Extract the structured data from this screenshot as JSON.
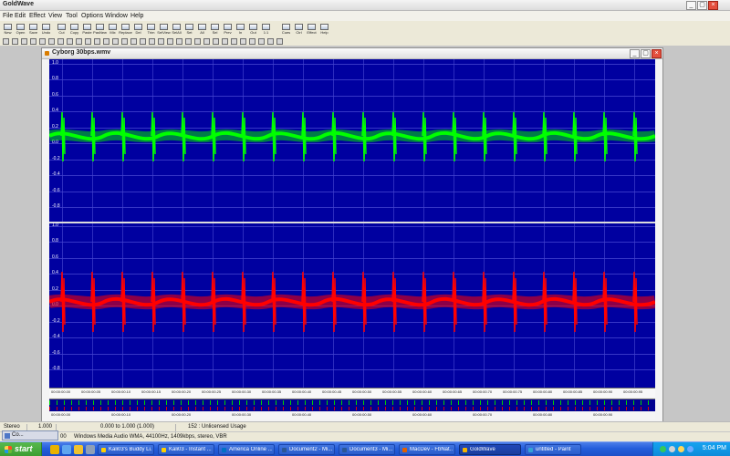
{
  "window": {
    "title": "GoldWave"
  },
  "menu": {
    "items": [
      "File",
      "Edit",
      "Effect",
      "View",
      "Tool",
      "Options",
      "Window",
      "Help"
    ]
  },
  "toolbar": {
    "main": [
      {
        "label": "New",
        "icon": "new-icon"
      },
      {
        "label": "Open",
        "icon": "open-icon"
      },
      {
        "label": "Save",
        "icon": "save-icon"
      },
      {
        "label": "Undo",
        "icon": "undo-icon"
      },
      {
        "label": "Cut",
        "icon": "cut-icon"
      },
      {
        "label": "Copy",
        "icon": "copy-icon"
      },
      {
        "label": "Paste",
        "icon": "paste-icon"
      },
      {
        "label": "PasNew",
        "icon": "paste-new-icon"
      },
      {
        "label": "Mix",
        "icon": "mix-icon"
      },
      {
        "label": "Replace",
        "icon": "replace-icon"
      },
      {
        "label": "Del",
        "icon": "delete-icon"
      },
      {
        "label": "Trim",
        "icon": "trim-icon"
      },
      {
        "label": "SelView",
        "icon": "select-view-icon"
      },
      {
        "label": "SelAll",
        "icon": "select-all-icon"
      },
      {
        "label": "Set",
        "icon": "set-icon"
      },
      {
        "label": "All",
        "icon": "all-icon"
      },
      {
        "label": "Sel",
        "icon": "select-icon"
      },
      {
        "label": "Prev",
        "icon": "prev-icon"
      },
      {
        "label": "In",
        "icon": "zoom-in-icon"
      },
      {
        "label": "Out",
        "icon": "zoom-out-icon"
      },
      {
        "label": "1:1",
        "icon": "zoom-one-icon"
      },
      {
        "label": "Cues",
        "icon": "cues-icon"
      },
      {
        "label": "Ctrl",
        "icon": "control-icon"
      },
      {
        "label": "Effect",
        "icon": "effect-icon"
      },
      {
        "label": "Help",
        "icon": "help-icon"
      }
    ]
  },
  "document": {
    "title": "Cyborg 30bps.wmv",
    "amplitude_labels": [
      "1.0",
      "0.8",
      "0.6",
      "0.4",
      "0.2",
      "0.0",
      "-0.2",
      "-0.4",
      "-0.6",
      "-0.8"
    ],
    "timeline_labels": [
      "00:00:00.00",
      "00:00:00.05",
      "00:00:00.10",
      "00:00:00.15",
      "00:00:00.20",
      "00:00:00.25",
      "00:00:00.30",
      "00:00:00.35",
      "00:00:00.40",
      "00:00:00.45",
      "00:00:00.50",
      "00:00:00.55",
      "00:00:00.60",
      "00:00:00.65",
      "00:00:00.70",
      "00:00:00.75",
      "00:00:00.80",
      "00:00:00.85",
      "00:00:00.90",
      "00:00:00.95"
    ],
    "overview_labels": [
      "00:00:00.00",
      "00:00:00.10",
      "00:00:00.20",
      "00:00:00.30",
      "00:00:00.40",
      "00:00:00.50",
      "00:00:00.60",
      "00:00:00.70",
      "00:00:00.80",
      "00:00:00.90"
    ],
    "channel_colors": {
      "left": "#00e000",
      "right": "#ff0000"
    }
  },
  "status": {
    "channel": "Stereo",
    "length": "1.000",
    "selection": "0.000 to 1.000 (1.000)",
    "license": "152 : Unlicensed Usage",
    "position": "00",
    "format": "Windows Media Audio WMA, 44100Hz, 1409kbps, stereo, VBR"
  },
  "minimized_window": {
    "title": "Co..."
  },
  "taskbar": {
    "start": "start",
    "tasks": [
      {
        "label": "Kali03's Buddy Li...",
        "color": "#ffd000"
      },
      {
        "label": "Kali03 - Instant ...",
        "color": "#ffd000"
      },
      {
        "label": "America Online ...",
        "color": "#0071c5"
      },
      {
        "label": "Document2 - Mi...",
        "color": "#2b5797"
      },
      {
        "label": "Document3 - Mi...",
        "color": "#2b5797"
      },
      {
        "label": "MacDev - FbNat...",
        "color": "#e06000"
      },
      {
        "label": "GoldWave",
        "color": "#f4b400"
      },
      {
        "label": "untitled - Paint",
        "color": "#33a3d5"
      }
    ],
    "clock": "5:04 PM"
  }
}
